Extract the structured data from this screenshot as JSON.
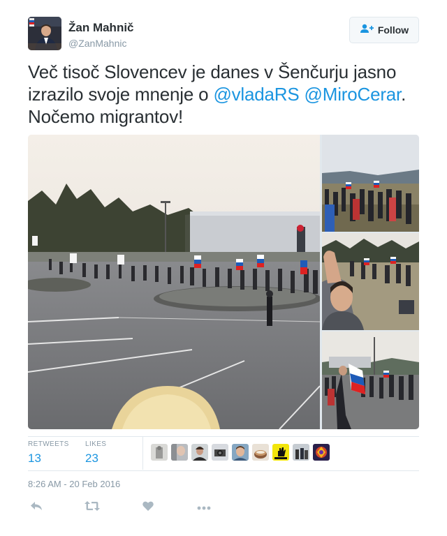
{
  "user": {
    "display_name": "Žan Mahnič",
    "handle": "@ZanMahnic",
    "avatar_icon": "profile-photo"
  },
  "follow_button": {
    "label": "Follow",
    "icon": "add-user-icon"
  },
  "tweet": {
    "text_part1": "Več tisoč Slovencev je danes v Šenčurju jasno izrazilo svoje mnenje o ",
    "mention1": "@vladaRS",
    "text_part2": " ",
    "mention2": "@MiroCerar",
    "text_part3": ". Nočemo migrantov!"
  },
  "media": {
    "photos": [
      "main-photo-march-parking-lot",
      "photo-crowd-field",
      "photo-selfie-crowd",
      "photo-man-with-flag"
    ]
  },
  "stats": {
    "retweets_label": "RETWEETS",
    "retweets_count": "13",
    "likes_label": "LIKES",
    "likes_count": "23"
  },
  "liker_avatars": [
    "avatar-1",
    "avatar-2",
    "avatar-3",
    "avatar-4",
    "avatar-5",
    "avatar-6",
    "avatar-7",
    "avatar-8",
    "avatar-9"
  ],
  "timestamp": "8:26 AM - 20 Feb 2016",
  "actions": {
    "reply_icon": "reply-icon",
    "retweet_icon": "retweet-icon",
    "like_icon": "heart-icon",
    "more_icon": "more-icon"
  },
  "colors": {
    "link": "#1b95e0",
    "muted": "#8899a6",
    "text": "#292f33",
    "border": "#e1e8ed"
  }
}
